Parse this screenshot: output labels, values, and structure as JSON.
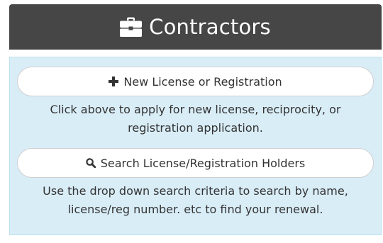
{
  "card": {
    "title": "Contractors",
    "header_icon": "briefcase-icon"
  },
  "actions": [
    {
      "label": "New License or Registration",
      "icon": "plus-icon",
      "description": "Click above to apply for new license, reciprocity, or registration application."
    },
    {
      "label": "Search License/Registration Holders",
      "icon": "search-icon",
      "description": "Use the drop down search criteria to search by name, license/reg number. etc to find your renewal."
    }
  ],
  "colors": {
    "header_bg": "#464646",
    "panel_bg": "#d9edf7",
    "panel_border": "#bce0ee",
    "text": "#333333"
  }
}
